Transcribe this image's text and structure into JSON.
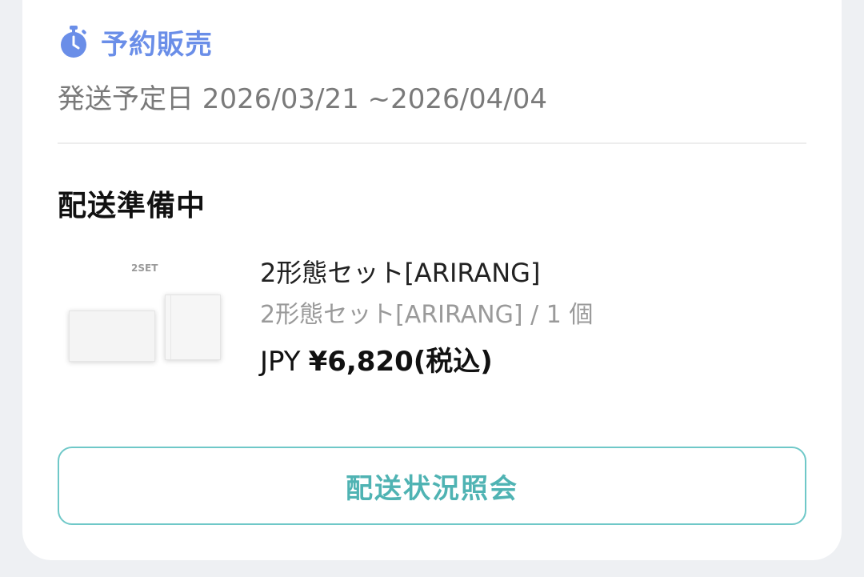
{
  "order": {
    "sale_type": {
      "icon": "stopwatch-icon",
      "label": "予約販売",
      "color": "#6a8ee8"
    },
    "shipping_schedule": "発送予定日 2026/03/21 ~2026/04/04",
    "status": "配送準備中",
    "item": {
      "thumbnail_caption": "2SET",
      "name": "2形態セット[ARIRANG]",
      "option": "2形態セット[ARIRANG] / 1 個",
      "currency": "JPY",
      "price": "¥6,820(税込)"
    },
    "track_button_label": "配送状況照会",
    "accent_color": "#4fb3b3"
  }
}
